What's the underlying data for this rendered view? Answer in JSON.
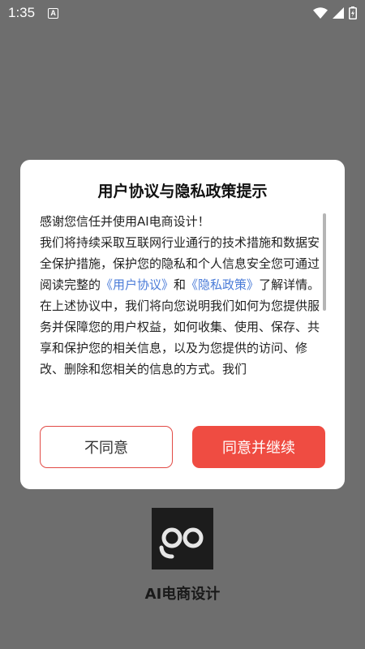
{
  "status_bar": {
    "time": "1:35",
    "notification_icon": "A",
    "icons": [
      "wifi-icon",
      "signal-icon",
      "battery-charging-icon"
    ]
  },
  "dialog": {
    "title": "用户协议与隐私政策提示",
    "body": {
      "p1": "感谢您信任并使用AI电商设计！",
      "p2_start": "我们将持续采取互联网行业通行的技术措施和数据安全保护措施，保护您的隐私和个人信息安全您可通过阅读完整的",
      "link_user_agreement": "《用户协议》",
      "p2_and": "和",
      "link_privacy_policy": "《隐私政策》",
      "p2_end": "了解详情。",
      "p3": "在上述协议中，我们将向您说明我们如何为您提供服务并保障您的用户权益，如何收集、使用、保存、共享和保护您的相关信息，以及为您提供的访问、修改、删除和您相关的信息的方式。我们"
    },
    "buttons": {
      "disagree": "不同意",
      "agree": "同意并继续"
    }
  },
  "app": {
    "name": "AI电商设计",
    "logo_icon": "app-logo-icon"
  },
  "colors": {
    "overlay": "#6e6e6e",
    "accent": "#ef4c42",
    "link": "#4a7bd8"
  }
}
